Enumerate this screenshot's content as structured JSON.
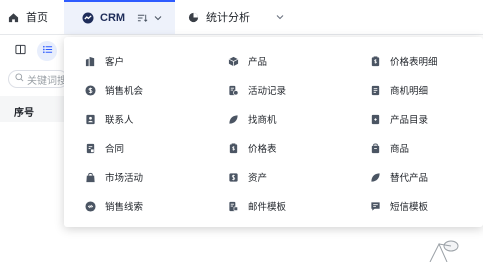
{
  "top_tabs": {
    "home": {
      "label": "首页",
      "icon": "home-icon"
    },
    "crm": {
      "label": "CRM",
      "icon": "crm-logo-icon",
      "extra_icon": "filter-sort-icon",
      "chevron": "chevron-down-icon"
    },
    "stat": {
      "label": "统计分析",
      "icon": "pie-chart-icon",
      "chevron": "chevron-down-icon"
    }
  },
  "toolbar": {
    "column_toggle_icon": "columns-icon",
    "list_view_icon": "list-icon"
  },
  "search": {
    "placeholder": "关键词搜"
  },
  "table": {
    "headers": [
      "序号"
    ]
  },
  "menu": {
    "columns": [
      [
        {
          "label": "客户",
          "icon": "building-icon"
        },
        {
          "label": "销售机会",
          "icon": "dollar-circle-icon"
        },
        {
          "label": "联系人",
          "icon": "contact-card-icon"
        },
        {
          "label": "合同",
          "icon": "contract-icon"
        },
        {
          "label": "市场活动",
          "icon": "shopping-bag-icon"
        },
        {
          "label": "销售线索",
          "icon": "link-circle-icon"
        }
      ],
      [
        {
          "label": "产品",
          "icon": "cube-icon"
        },
        {
          "label": "活动记录",
          "icon": "activity-record-icon"
        },
        {
          "label": "找商机",
          "icon": "leaf-icon"
        },
        {
          "label": "价格表",
          "icon": "price-tag-doc-icon"
        },
        {
          "label": "资产",
          "icon": "asset-dollar-icon"
        },
        {
          "label": "邮件模板",
          "icon": "mail-template-icon"
        }
      ],
      [
        {
          "label": "价格表明细",
          "icon": "price-detail-icon"
        },
        {
          "label": "商机明细",
          "icon": "opportunity-detail-icon"
        },
        {
          "label": "产品目录",
          "icon": "catalog-icon"
        },
        {
          "label": "商品",
          "icon": "goods-icon"
        },
        {
          "label": "替代产品",
          "icon": "substitute-leaf-icon"
        },
        {
          "label": "短信模板",
          "icon": "sms-template-icon"
        }
      ]
    ]
  },
  "colors": {
    "accent": "#2e5bff",
    "icon": "#4b5563",
    "text": "#1f2329"
  }
}
